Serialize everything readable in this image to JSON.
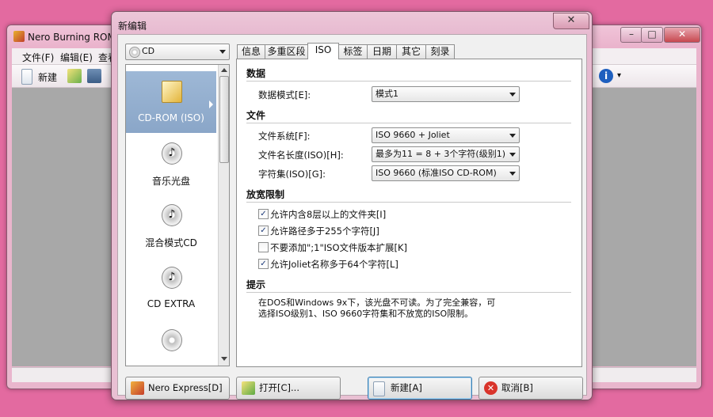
{
  "main_window": {
    "title": "Nero Burning ROM",
    "menu": [
      "文件(F)",
      "编辑(E)",
      "查看"
    ],
    "toolbar_new_label": "新建"
  },
  "dialog": {
    "title": "新编辑",
    "close_glyph": "✕",
    "media_type": "CD",
    "media_items": [
      {
        "label": "CD-ROM (ISO)",
        "icon": "cdrom-iso-icon",
        "selected": true
      },
      {
        "label": "音乐光盘",
        "icon": "audio-cd-icon",
        "selected": false
      },
      {
        "label": "混合模式CD",
        "icon": "mixed-mode-cd-icon",
        "selected": false
      },
      {
        "label": "CD EXTRA",
        "icon": "cd-extra-icon",
        "selected": false
      }
    ],
    "tabs": [
      "信息",
      "多重区段",
      "ISO",
      "标签",
      "日期",
      "其它",
      "刻录"
    ],
    "active_tab": "ISO",
    "iso": {
      "data_section": "数据",
      "data_mode_label": "数据模式[E]:",
      "data_mode_value": "模式1",
      "file_section": "文件",
      "filesystem_label": "文件系统[F]:",
      "filesystem_value": "ISO 9660 + Joliet",
      "filename_length_label": "文件名长度(ISO)[H]:",
      "filename_length_value": "最多为11 = 8 + 3个字符(级别1)",
      "charset_label": "字符集(ISO)[G]:",
      "charset_value": "ISO 9660 (标准ISO CD-ROM)",
      "relax_section": "放宽限制",
      "options": [
        {
          "label": "允许内含8层以上的文件夹[I]",
          "checked": true
        },
        {
          "label": "允许路径多于255个字符[J]",
          "checked": true
        },
        {
          "label": "不要添加\";1\"ISO文件版本扩展[K]",
          "checked": false
        },
        {
          "label": "允许Joliet名称多于64个字符[L]",
          "checked": true
        }
      ],
      "hint_section": "提示",
      "hint_line1": "在DOS和Windows 9x下，该光盘不可读。为了完全兼容，可",
      "hint_line2": "选择ISO级别1、ISO 9660字符集和不放宽的ISO限制。"
    },
    "buttons": {
      "nero_express": "Nero Express[D]",
      "open": "打开[C]...",
      "new": "新建[A]",
      "cancel": "取消[B]"
    }
  },
  "check_glyph": "✓"
}
